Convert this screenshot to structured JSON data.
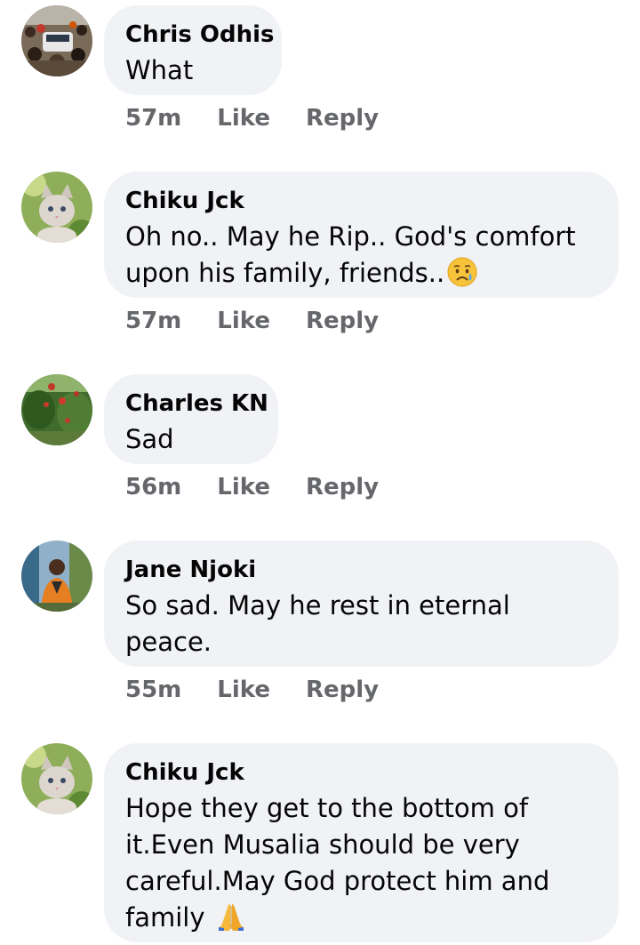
{
  "comments": [
    {
      "author": "Chris Odhis",
      "text": "What",
      "time": "57m",
      "like_label": "Like",
      "reply_label": "Reply",
      "avatar": "crowd-photo"
    },
    {
      "author": "Chiku Jck",
      "text": "Oh no.. May he Rip.. God's comfort upon his family, friends..",
      "emoji": "sad-tear-face-emoji",
      "time": "57m",
      "like_label": "Like",
      "reply_label": "Reply",
      "avatar": "kitten-photo"
    },
    {
      "author": "Charles KN",
      "text": "Sad",
      "time": "56m",
      "like_label": "Like",
      "reply_label": "Reply",
      "avatar": "garden-photo"
    },
    {
      "author": "Jane Njoki",
      "text": "So sad. May he rest in eternal peace.",
      "time": "55m",
      "like_label": "Like",
      "reply_label": "Reply",
      "avatar": "woman-photo"
    },
    {
      "author": "Chiku Jck",
      "text": "Hope they get to the bottom of it.Even Musalia should be very careful.May God protect him and family",
      "emoji": "praying-hands-emoji",
      "time": "",
      "like_label": "",
      "reply_label": "",
      "avatar": "kitten-photo"
    }
  ],
  "colors": {
    "bubble": "#f0f2f5",
    "text": "#050505",
    "meta": "#65676b"
  }
}
